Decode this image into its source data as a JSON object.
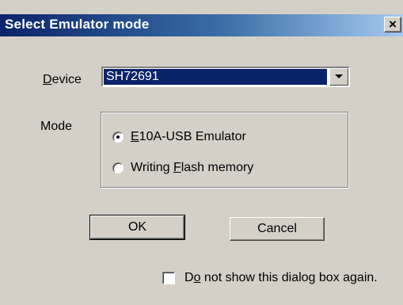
{
  "dialog": {
    "title": "Select Emulator mode",
    "close_glyph": "×",
    "close_icon": "close-icon"
  },
  "device": {
    "label_prefix": "",
    "label_underline": "D",
    "label_rest": "evice",
    "selected_value": "SH72691",
    "dropdown_icon": "chevron-down-icon"
  },
  "mode": {
    "label": "Mode",
    "options": [
      {
        "underline": "E",
        "rest": "10A-USB Emulator",
        "selected": true
      },
      {
        "prefix": "Writing ",
        "underline": "F",
        "rest": "lash memory",
        "selected": false
      }
    ]
  },
  "buttons": {
    "ok": "OK",
    "cancel": "Cancel"
  },
  "dont_show": {
    "prefix": "D",
    "underline": "o",
    "rest": " not show this dialog box again.",
    "checked": false
  },
  "colors": {
    "titlebar_start": "#0a246a",
    "titlebar_end": "#a6caf0",
    "face": "#d4d0c8",
    "selection": "#0a246a"
  }
}
